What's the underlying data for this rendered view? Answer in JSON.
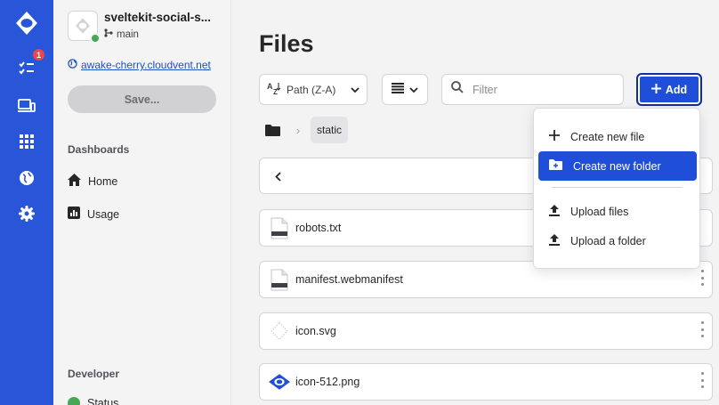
{
  "rail": {
    "accent": "#2956d9",
    "items": [
      {
        "name": "logo-icon"
      },
      {
        "name": "tasks-icon",
        "badge": "1"
      },
      {
        "name": "devices-icon"
      },
      {
        "name": "apps-grid-icon"
      },
      {
        "name": "globe-icon"
      },
      {
        "name": "gear-icon"
      }
    ]
  },
  "sidebar": {
    "site_name": "sveltekit-social-s...",
    "branch": "main",
    "url": "awake-cherry.cloudvent.net",
    "save_label": "Save...",
    "dashboards_heading": "Dashboards",
    "dashboards": [
      {
        "label": "Home",
        "icon": "home-icon"
      },
      {
        "label": "Usage",
        "icon": "usage-icon"
      }
    ],
    "developer_heading": "Developer",
    "developer": [
      {
        "label": "Status",
        "icon": "status-icon"
      }
    ]
  },
  "main": {
    "title": "Files",
    "sort_label": "Path (Z-A)",
    "filter_placeholder": "Filter",
    "add_label": "Add",
    "breadcrumb": {
      "current": "static"
    },
    "files": [
      {
        "name": "robots.txt",
        "icon": "text-file-icon"
      },
      {
        "name": "manifest.webmanifest",
        "icon": "file-icon"
      },
      {
        "name": "icon.svg",
        "icon": "svg-file-icon"
      },
      {
        "name": "icon-512.png",
        "icon": "image-file-icon"
      }
    ]
  },
  "add_menu": {
    "items": [
      {
        "label": "Create new file",
        "icon": "plus-icon"
      },
      {
        "label": "Create new folder",
        "icon": "new-folder-icon",
        "active": true
      },
      {
        "label": "Upload files",
        "icon": "upload-icon"
      },
      {
        "label": "Upload a folder",
        "icon": "upload-folder-icon"
      }
    ]
  },
  "colors": {
    "primary": "#1f4fd8",
    "success": "#46a758",
    "badge": "#e5484d"
  }
}
